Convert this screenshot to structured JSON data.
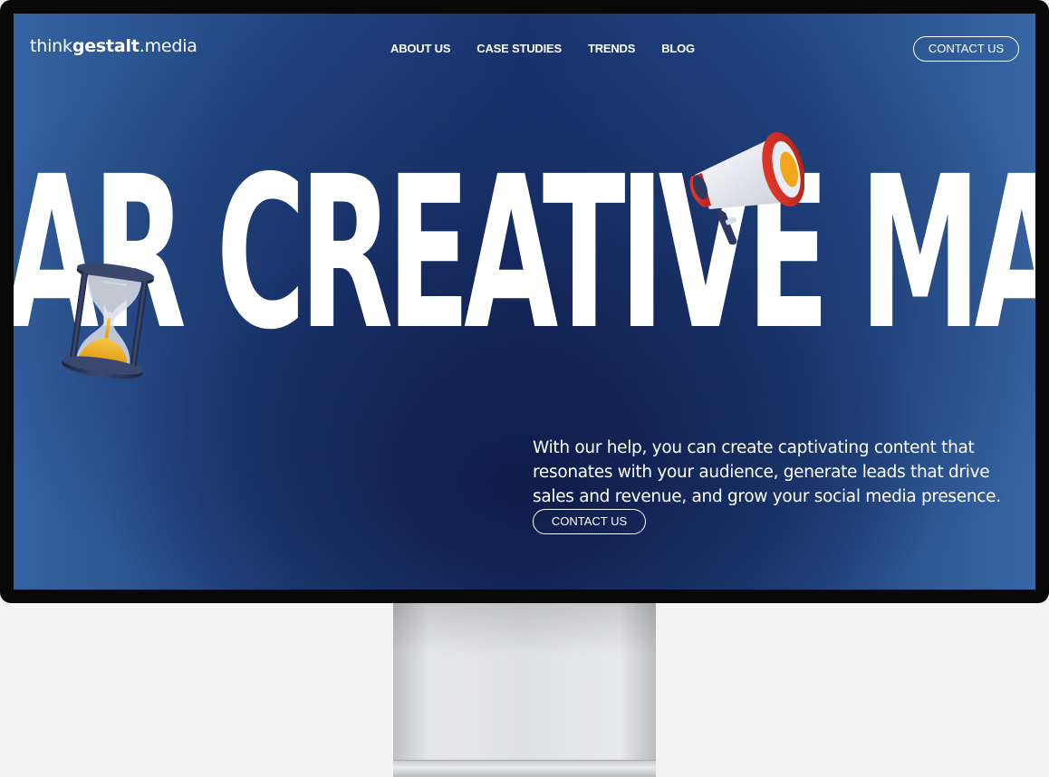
{
  "brand": {
    "prefix": "think",
    "bold": "gestalt",
    "suffix": ".media"
  },
  "nav": {
    "items": [
      "ABOUT US",
      "CASE STUDIES",
      "TRENDS",
      "BLOG"
    ]
  },
  "header": {
    "contact_label": "CONTACT US"
  },
  "hero": {
    "marquee_text": "AR CREATIVE MAR",
    "description": "With our help, you can create captivating content that resonates with your audience, generate leads that drive sales and revenue, and grow your social media presence.",
    "cta_label": "CONTACT US"
  },
  "icons": [
    "hourglass-icon",
    "megaphone-icon"
  ],
  "colors": {
    "accent_blue": "#2a4f8c",
    "dark_blue": "#0f1d4a",
    "text": "#ffffff"
  }
}
